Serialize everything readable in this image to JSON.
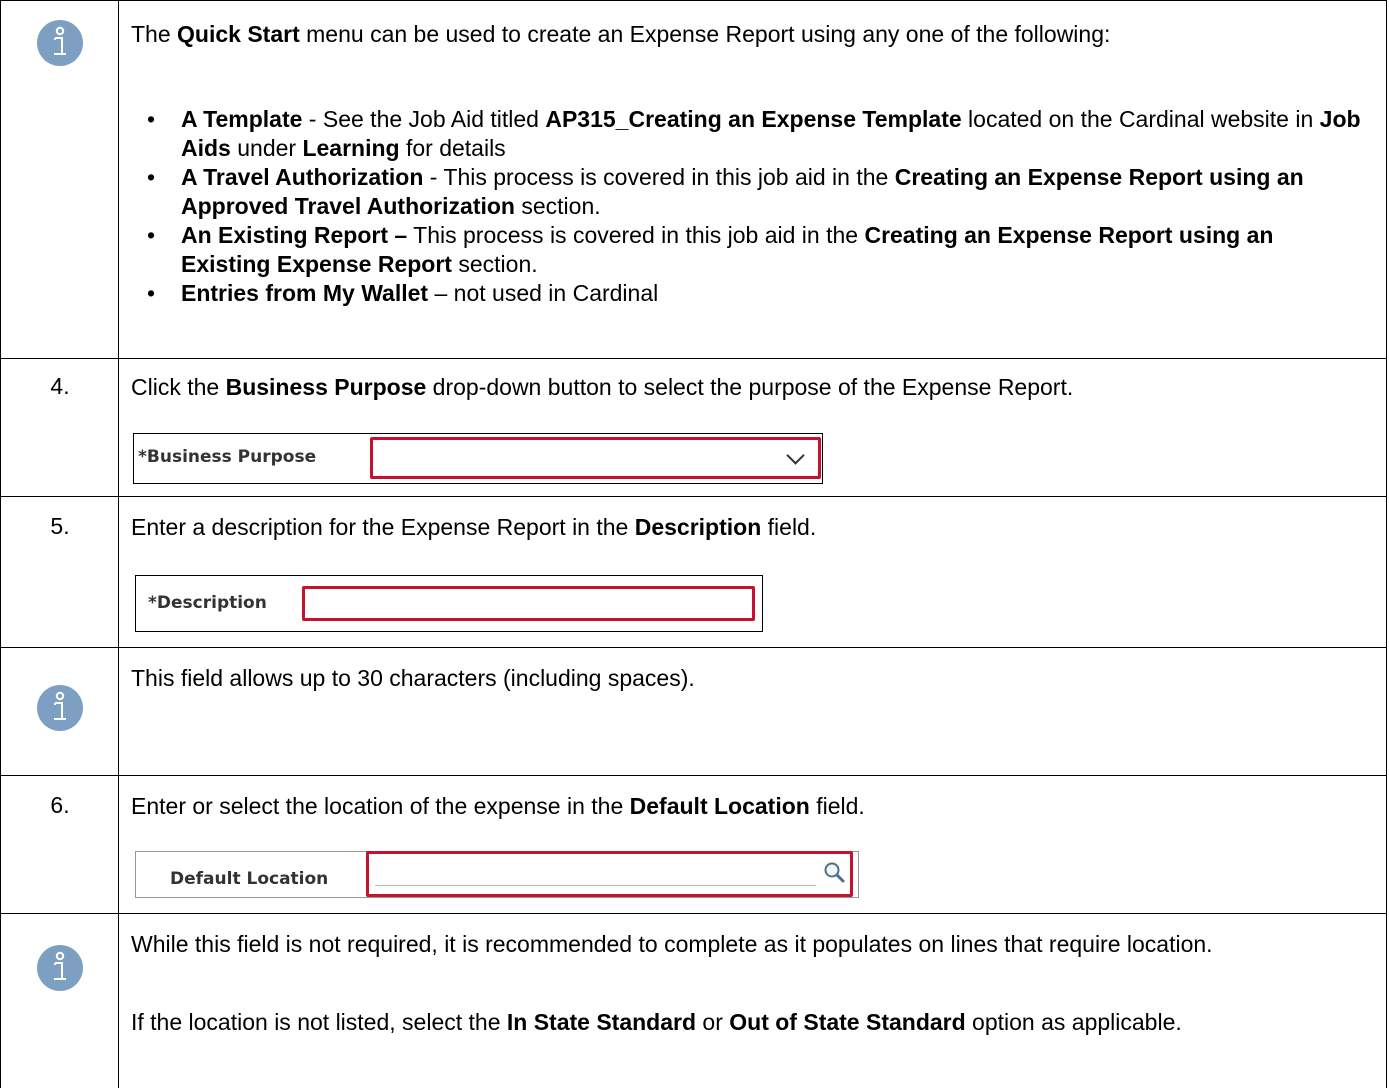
{
  "intro_info": {
    "p1_a": "The ",
    "p1_b": "Quick Start",
    "p1_c": " menu can be used to create an Expense Report using any one of the following:",
    "bullets": [
      {
        "a": "A Template",
        "b": " - See the Job Aid titled ",
        "c": "AP315_Creating an Expense Template",
        "d": " located on the Cardinal website in ",
        "e": "Job Aids",
        "f": " under ",
        "g": "Learning",
        "h": " for details"
      },
      {
        "a": "A Travel Authorization",
        "b": " - This process is covered in this job aid in the ",
        "c": "Creating an Expense Report using an Approved Travel Authorization",
        "d": " section."
      },
      {
        "a": "An Existing Report –",
        "b": " This process is covered in this job aid in the ",
        "c": "Creating an Expense Report using an Existing Expense Report",
        "d": " section."
      },
      {
        "a": "Entries from My Wallet",
        "b": " – not used in Cardinal"
      }
    ]
  },
  "step4": {
    "num": "4.",
    "t1": "Click the ",
    "t2": "Business Purpose",
    "t3": " drop-down button to select the purpose of the Expense Report.",
    "field_label": "*Business Purpose",
    "field_value": ""
  },
  "step5": {
    "num": "5.",
    "t1": "Enter a description for the Expense Report in the ",
    "t2": "Description",
    "t3": " field.",
    "field_label": "*Description",
    "field_value": ""
  },
  "info_chars": {
    "text": "This field allows up to 30 characters (including spaces)."
  },
  "step6": {
    "num": "6.",
    "t1": "Enter or select the location of the expense in the ",
    "t2": "Default Location",
    "t3": " field.",
    "field_label": "Default Location",
    "field_value": ""
  },
  "info_location": {
    "p1": "While this field is not required, it is recommended to complete as it populates on lines that require location.",
    "p2_a": "If the location is not listed, select the ",
    "p2_b": "In State Standard",
    "p2_c": " or ",
    "p2_d": "Out of State Standard",
    "p2_e": " option as applicable."
  },
  "colors": {
    "info_icon": "#7d9fc2",
    "highlight_red": "#c41230"
  },
  "icons": [
    "info-icon",
    "chevron-down-icon",
    "search-icon"
  ]
}
